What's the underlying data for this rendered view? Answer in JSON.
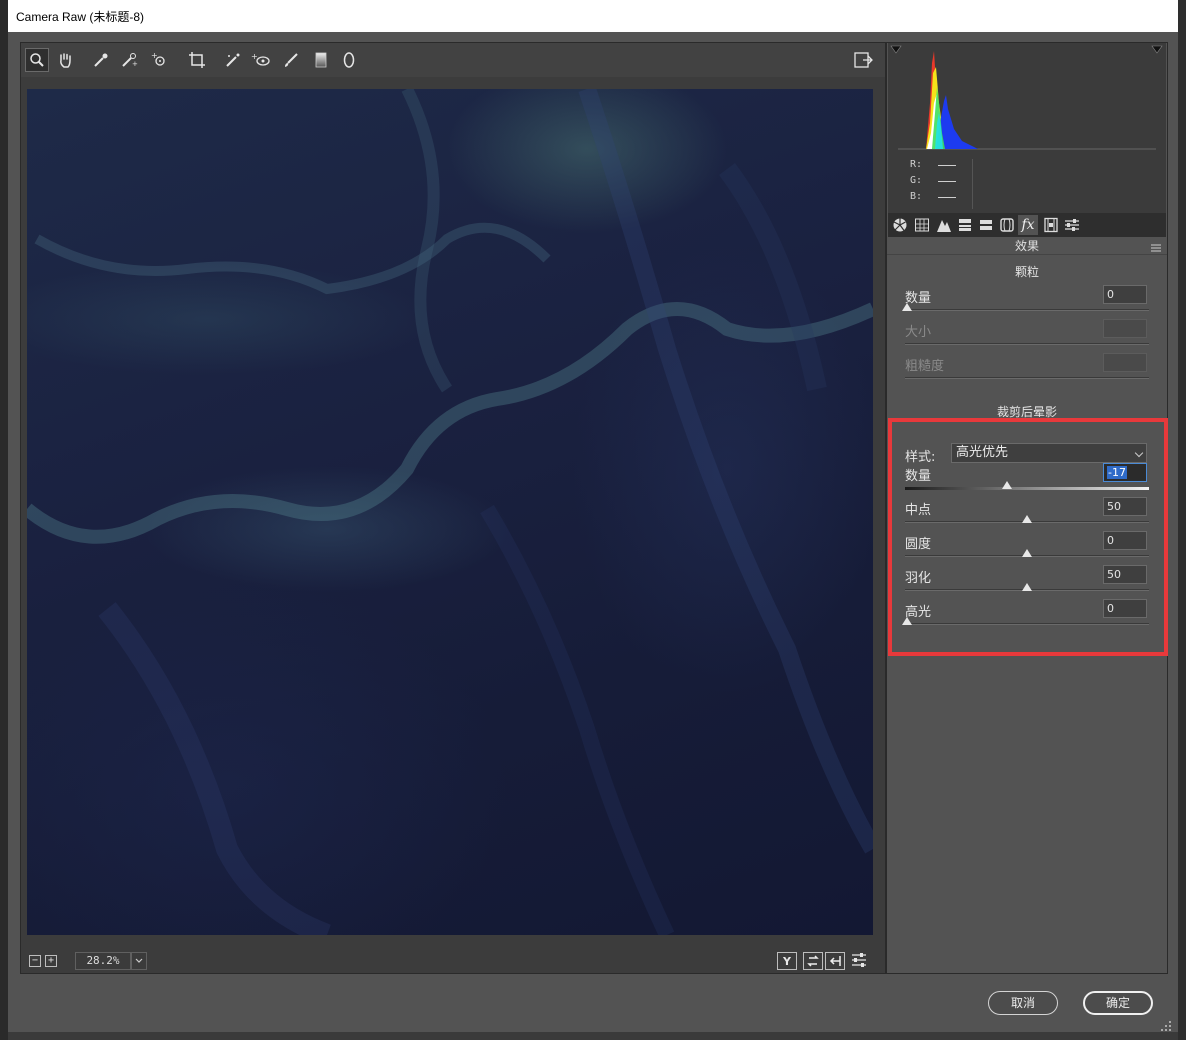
{
  "window": {
    "title": "Camera Raw (未标题-8)"
  },
  "toolbar": {
    "tools": [
      "zoom-icon",
      "hand-icon",
      "white-balance-icon",
      "color-sampler-icon",
      "targeted-adjustment-icon",
      "crop-icon",
      "straighten-icon",
      "spot-removal-icon",
      "brush-icon",
      "graduated-filter-icon",
      "radial-filter-icon"
    ]
  },
  "view": {
    "zoom": "28.2%",
    "ab_label": "Y"
  },
  "histogram": {
    "r_label": "R:",
    "g_label": "G:",
    "b_label": "B:"
  },
  "tabs": [
    "basic-icon",
    "tone-curve-icon",
    "detail-icon",
    "hsl-icon",
    "split-toning-icon",
    "lens-icon",
    "fx-icon",
    "camera-calibration-icon",
    "presets-icon"
  ],
  "panel": {
    "title": "效果",
    "grain": {
      "title": "颗粒",
      "amount_label": "数量",
      "amount_value": "0",
      "size_label": "大小",
      "roughness_label": "粗糙度"
    },
    "vignette": {
      "title": "裁剪后晕影",
      "style_label": "样式:",
      "style_value": "高光优先",
      "amount_label": "数量",
      "amount_value": "-17",
      "midpoint_label": "中点",
      "midpoint_value": "50",
      "roundness_label": "圆度",
      "roundness_value": "0",
      "feather_label": "羽化",
      "feather_value": "50",
      "highlights_label": "高光",
      "highlights_value": "0"
    }
  },
  "sliders": {
    "grain_amount": 0.0,
    "vignette_amount": 0.415,
    "midpoint": 0.5,
    "roundness": 0.5,
    "feather": 0.5,
    "highlights": 0.0
  },
  "buttons": {
    "cancel": "取消",
    "ok": "确定"
  },
  "colors": {
    "highlight_box": "#e8393b",
    "panel_bg": "#535353"
  }
}
